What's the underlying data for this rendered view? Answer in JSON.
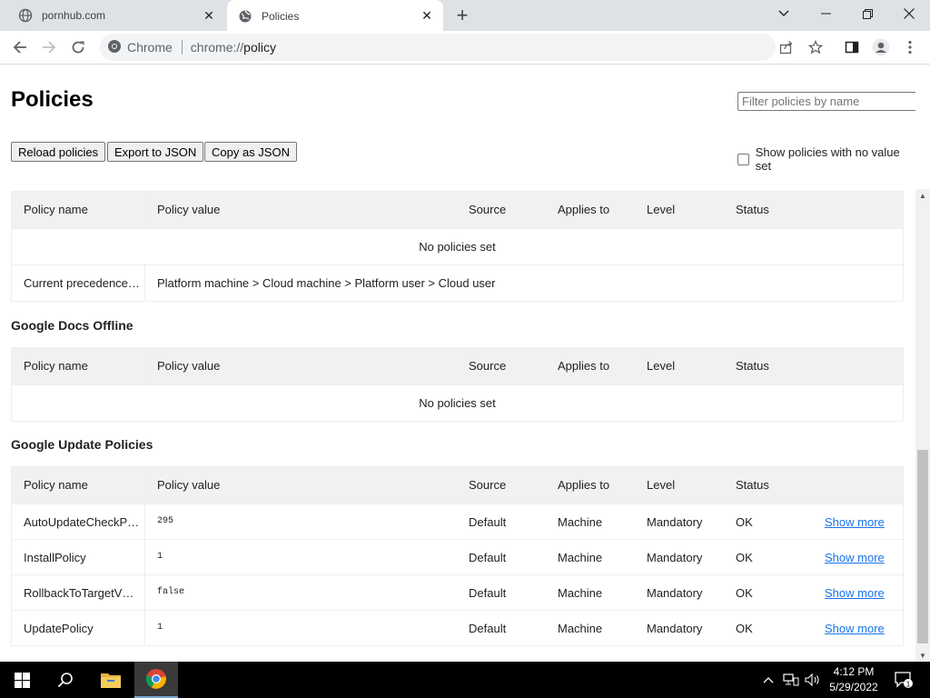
{
  "browser": {
    "tabs": [
      {
        "title": "pornhub.com",
        "active": false
      },
      {
        "title": "Policies",
        "active": true
      }
    ],
    "omnibox": {
      "label": "Chrome",
      "url_prefix": "chrome://",
      "url_host": "policy"
    }
  },
  "page": {
    "title": "Policies",
    "filter_placeholder": "Filter policies by name",
    "buttons": {
      "reload": "Reload policies",
      "export": "Export to JSON",
      "copy": "Copy as JSON"
    },
    "show_no_value_label": "Show policies with no value set",
    "columns": {
      "name": "Policy name",
      "value": "Policy value",
      "source": "Source",
      "applies": "Applies to",
      "level": "Level",
      "status": "Status"
    },
    "chrome_section": {
      "empty_text": "No policies set",
      "precedence_name": "Current precedence…",
      "precedence_value": "Platform machine > Cloud machine > Platform user > Cloud user"
    },
    "docs_offline": {
      "title": "Google Docs Offline",
      "empty_text": "No policies set"
    },
    "google_update": {
      "title": "Google Update Policies",
      "rows": [
        {
          "name": "AutoUpdateCheckP…",
          "value": "295",
          "source": "Default",
          "applies": "Machine",
          "level": "Mandatory",
          "status": "OK",
          "more": "Show more"
        },
        {
          "name": "InstallPolicy",
          "value": "1",
          "source": "Default",
          "applies": "Machine",
          "level": "Mandatory",
          "status": "OK",
          "more": "Show more"
        },
        {
          "name": "RollbackToTargetV…",
          "value": "false",
          "source": "Default",
          "applies": "Machine",
          "level": "Mandatory",
          "status": "OK",
          "more": "Show more"
        },
        {
          "name": "UpdatePolicy",
          "value": "1",
          "source": "Default",
          "applies": "Machine",
          "level": "Mandatory",
          "status": "OK",
          "more": "Show more"
        }
      ]
    }
  },
  "taskbar": {
    "time": "4:12 PM",
    "date": "5/29/2022",
    "notification_count": "1"
  },
  "colors": {
    "link": "#1a73e8",
    "tab_strip": "#dee1e6",
    "header_row": "#f1f1f1"
  }
}
